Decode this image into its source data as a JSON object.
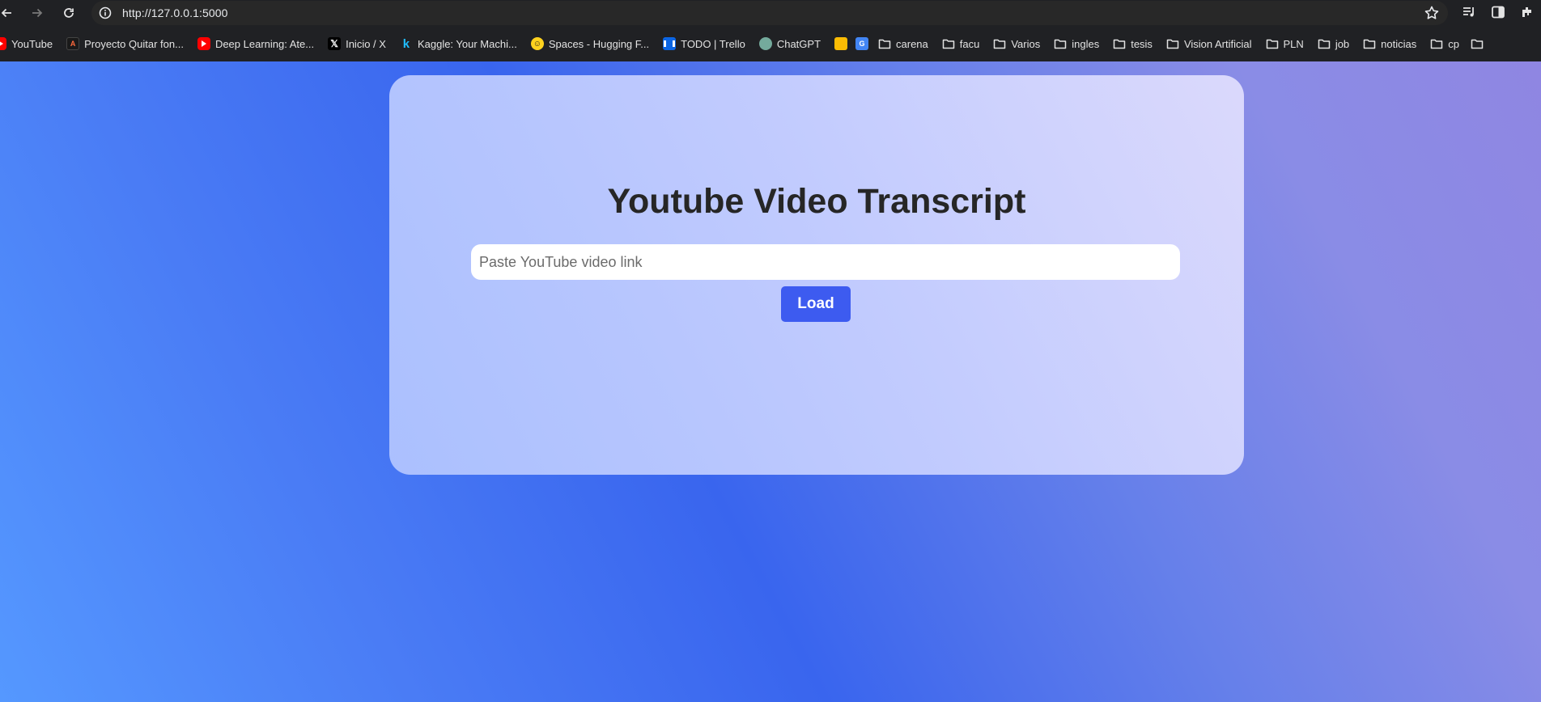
{
  "browser": {
    "url": "http://127.0.0.1:5000"
  },
  "bookmarks": [
    {
      "label": "YouTube",
      "icon": "youtube-icon"
    },
    {
      "label": "Proyecto Quitar fon...",
      "icon": "adobe-icon"
    },
    {
      "label": "Deep Learning: Ate...",
      "icon": "youtube-icon"
    },
    {
      "label": "Inicio / X",
      "icon": "x-icon"
    },
    {
      "label": "Kaggle: Your Machi...",
      "icon": "kaggle-icon"
    },
    {
      "label": "Spaces - Hugging F...",
      "icon": "huggingface-icon"
    },
    {
      "label": "TODO | Trello",
      "icon": "trello-icon"
    },
    {
      "label": "ChatGPT",
      "icon": "chatgpt-icon"
    },
    {
      "label": "",
      "icon": "keep-icon"
    },
    {
      "label": "",
      "icon": "google-translate-icon"
    },
    {
      "label": "carena",
      "icon": "folder-icon"
    },
    {
      "label": "facu",
      "icon": "folder-icon"
    },
    {
      "label": "Varios",
      "icon": "folder-icon"
    },
    {
      "label": "ingles",
      "icon": "folder-icon"
    },
    {
      "label": "tesis",
      "icon": "folder-icon"
    },
    {
      "label": "Vision Artificial",
      "icon": "folder-icon"
    },
    {
      "label": "PLN",
      "icon": "folder-icon"
    },
    {
      "label": "job",
      "icon": "folder-icon"
    },
    {
      "label": "noticias",
      "icon": "folder-icon"
    },
    {
      "label": "cp",
      "icon": "folder-icon"
    },
    {
      "label": "",
      "icon": "folder-icon"
    }
  ],
  "page": {
    "title": "Youtube Video Transcript",
    "input_placeholder": "Paste YouTube video link",
    "input_value": "",
    "load_label": "Load"
  },
  "colors": {
    "accent": "#3d5bf0",
    "background_start": "#5598ff",
    "background_mid": "#3965ee",
    "background_end": "#8f86e2"
  }
}
